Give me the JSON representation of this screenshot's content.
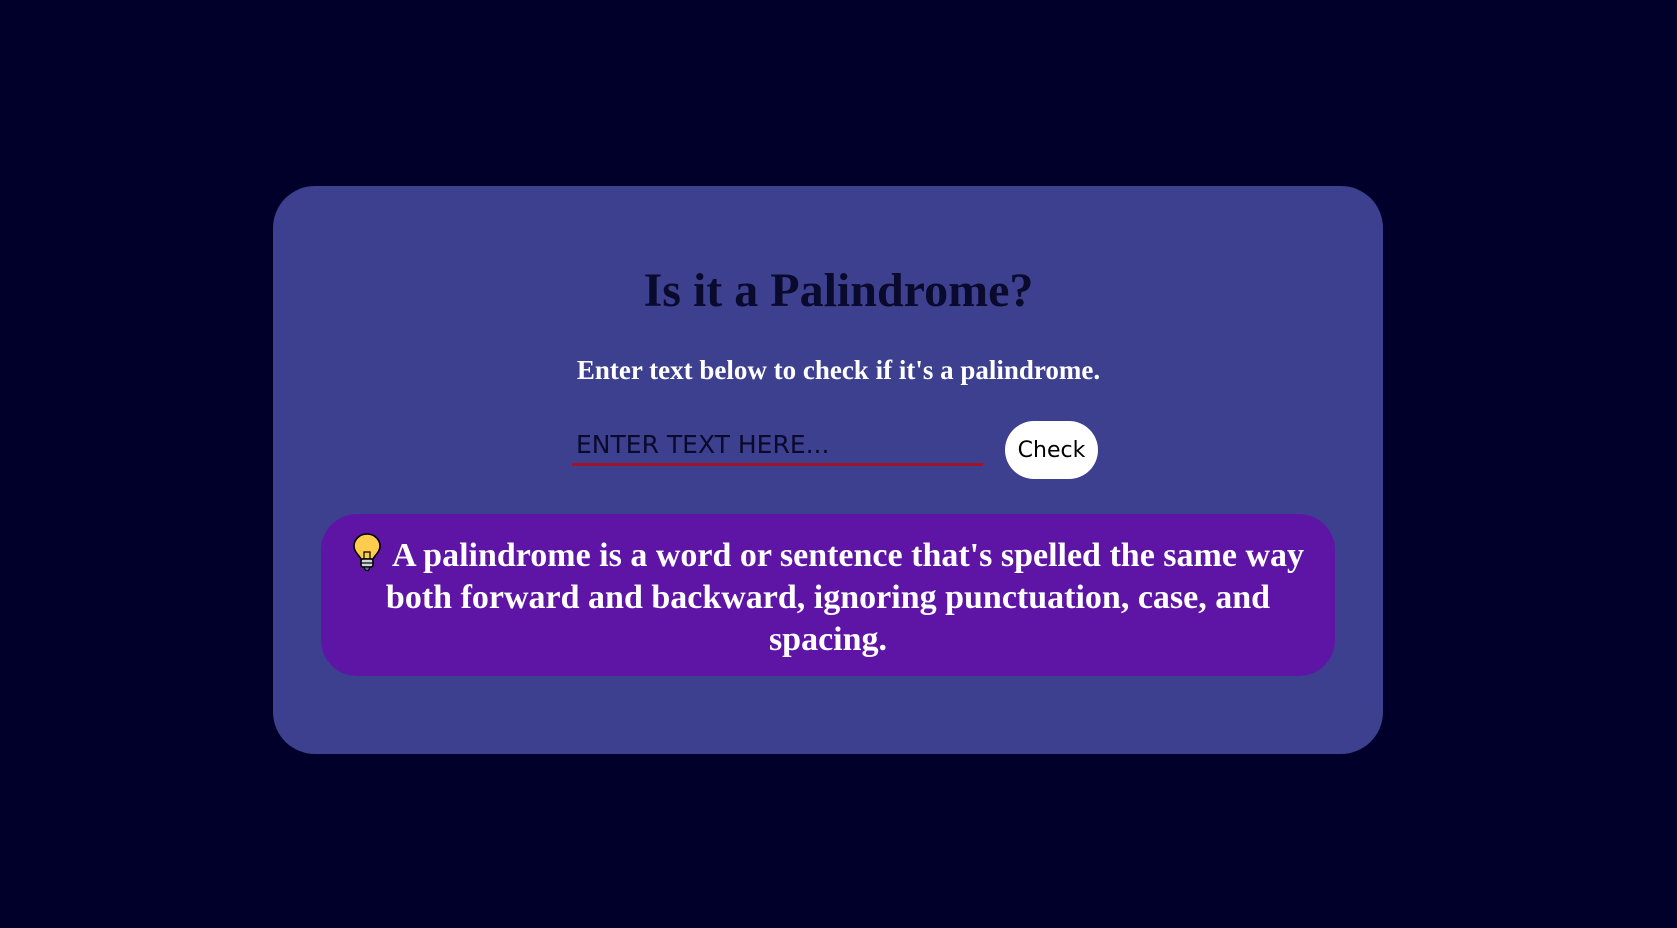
{
  "page": {
    "title": "Is it a Palindrome?",
    "subtitle": "Enter text below to check if it's a palindrome."
  },
  "form": {
    "input_placeholder": "ENTER TEXT HERE...",
    "input_value": "",
    "check_label": "Check"
  },
  "info": {
    "icon": "lightbulb-icon",
    "text": "A palindrome is a word or sentence that's spelled the same way both forward and backward, ignoring punctuation, case, and spacing."
  },
  "colors": {
    "background": "#00002b",
    "card": "#3d3f8f",
    "info_box": "#5e15a6",
    "input_underline": "#a0142a",
    "button": "#ffffff"
  }
}
